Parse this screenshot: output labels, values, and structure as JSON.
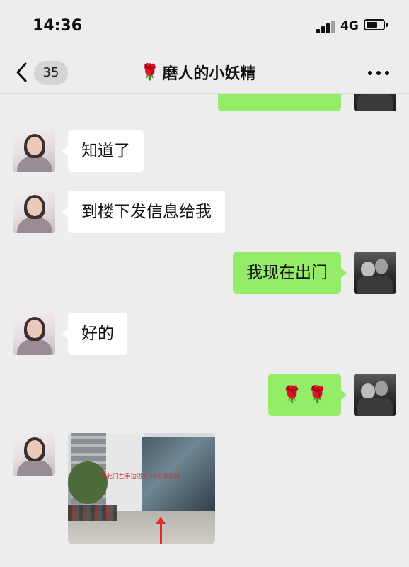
{
  "status_bar": {
    "time": "14:36",
    "network": "4G",
    "icons": [
      "signal-icon",
      "battery-icon"
    ]
  },
  "nav": {
    "unread_count": "35",
    "title_emoji": "🌹",
    "title": "磨人的小妖精",
    "icons": [
      "back-chevron-icon",
      "more-dots-icon"
    ]
  },
  "messages": [
    {
      "from": "partner",
      "text": "知道了"
    },
    {
      "from": "partner",
      "text": "到楼下发信息给我"
    },
    {
      "from": "me",
      "text": "我现在出门"
    },
    {
      "from": "partner",
      "text": "好的"
    },
    {
      "from": "me",
      "text": "🌹 🌹"
    },
    {
      "from": "partner",
      "type": "image",
      "overlay_text": "从此门左手边进入30号楼电梯"
    }
  ],
  "colors": {
    "background": "#ededed",
    "incoming_bubble": "#ffffff",
    "outgoing_bubble": "#95ec69",
    "annotation": "#e02b2b"
  }
}
